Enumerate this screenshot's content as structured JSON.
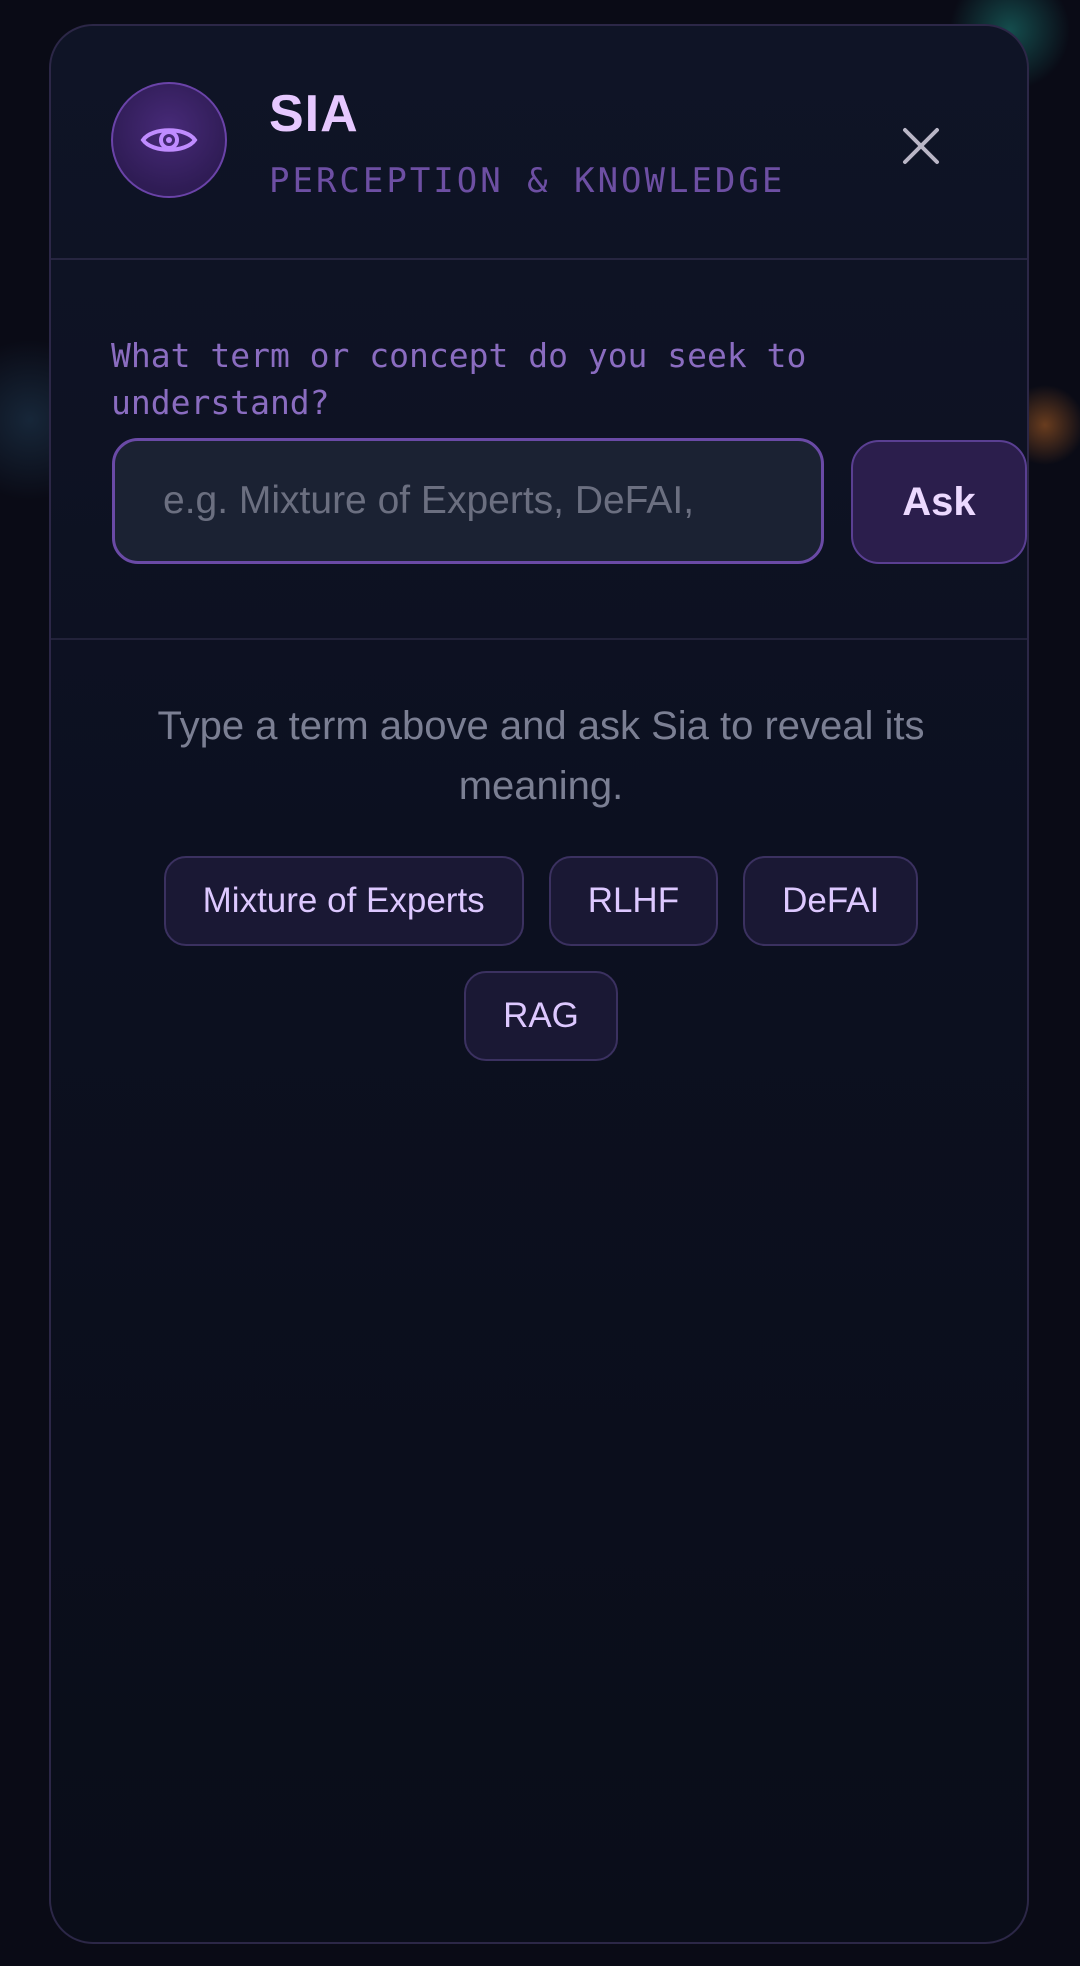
{
  "header": {
    "title": "SIA",
    "subtitle": "PERCEPTION & KNOWLEDGE",
    "avatar_icon": "eye-icon",
    "close_icon": "close-icon"
  },
  "query": {
    "prompt": "What term or concept do you seek to understand?",
    "placeholder": "e.g. Mixture of Experts, DeFAI,",
    "ask_label": "Ask"
  },
  "empty_state": {
    "hint": "Type a term above and ask Sia to reveal its meaning.",
    "suggestions": [
      "Mixture of Experts",
      "RLHF",
      "DeFAI",
      "RAG"
    ]
  },
  "colors": {
    "accent": "#e6c8ff",
    "subtitle": "#6d4fa3",
    "panel_bg": "#0f1426",
    "button_bg": "#2b1e4c"
  }
}
